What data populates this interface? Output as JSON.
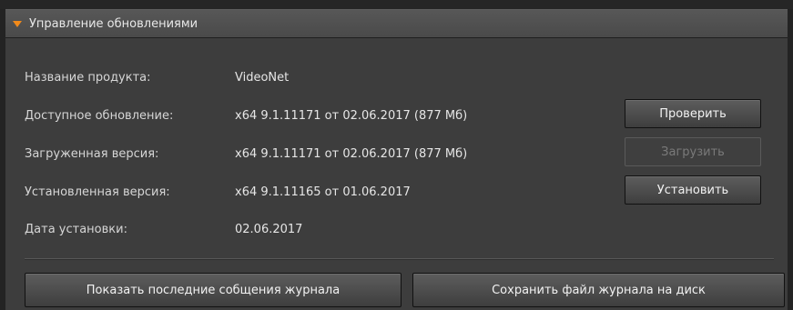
{
  "panel": {
    "title": "Управление обновлениями"
  },
  "fields": [
    {
      "label": "Название продукта:",
      "value": "VideoNet"
    },
    {
      "label": "Доступное обновление:",
      "value": "x64 9.1.11171 от 02.06.2017 (877 Мб)"
    },
    {
      "label": "Загруженная версия:",
      "value": "x64 9.1.11171 от 02.06.2017 (877 Мб)"
    },
    {
      "label": "Установленная версия:",
      "value": "x64 9.1.11165 от 01.06.2017"
    },
    {
      "label": "Дата установки:",
      "value": "02.06.2017"
    }
  ],
  "buttons": {
    "check": "Проверить",
    "download": "Загрузить",
    "install": "Установить",
    "show_log": "Показать последние собщения журнала",
    "save_log": "Сохранить файл журнала на диск"
  },
  "colors": {
    "accent_arrow": "#f28a1a",
    "panel_bg": "#3d3d3d"
  }
}
